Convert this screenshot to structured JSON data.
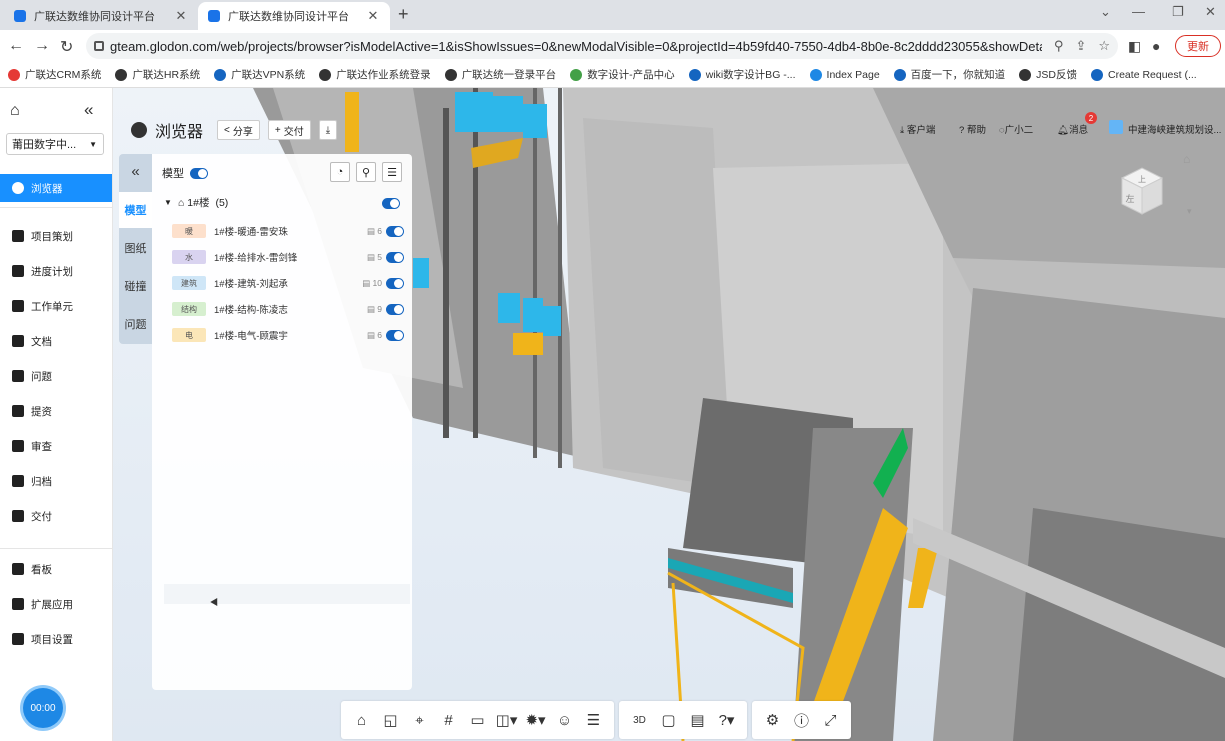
{
  "browser": {
    "tabs": [
      {
        "title": "广联达数维协同设计平台",
        "active": false
      },
      {
        "title": "广联达数维协同设计平台",
        "active": true
      }
    ],
    "url": "gteam.glodon.com/web/projects/browser?isModelActive=1&isShowIssues=0&newModalVisible=0&projectId=4b59fd40-7550-4db4-8b0e-8c2dddd23055&showDetail=0",
    "update_label": "更新",
    "bookmarks": [
      {
        "label": "广联达CRM系统",
        "color": "#e53935"
      },
      {
        "label": "广联达HR系统",
        "color": "#333333"
      },
      {
        "label": "广联达VPN系统",
        "color": "#1565c0"
      },
      {
        "label": "广联达作业系统登录",
        "color": "#333333"
      },
      {
        "label": "广联达统一登录平台",
        "color": "#333333"
      },
      {
        "label": "数字设计-产品中心",
        "color": "#43a047"
      },
      {
        "label": "wiki数字设计BG -...",
        "color": "#1565c0"
      },
      {
        "label": "Index Page",
        "color": "#1e88e5"
      },
      {
        "label": "百度一下，你就知道",
        "color": "#1565c0"
      },
      {
        "label": "JSD反馈",
        "color": "#333333"
      },
      {
        "label": "Create Request (...",
        "color": "#1565c0"
      }
    ]
  },
  "nav": {
    "project": "莆田数字中...",
    "items": [
      {
        "label": "浏览器",
        "active": true
      },
      {
        "label": "项目策划",
        "active": false
      },
      {
        "label": "进度计划",
        "active": false
      },
      {
        "label": "工作单元",
        "active": false
      },
      {
        "label": "文档",
        "active": false
      },
      {
        "label": "问题",
        "active": false
      },
      {
        "label": "提资",
        "active": false
      },
      {
        "label": "审查",
        "active": false
      },
      {
        "label": "归档",
        "active": false
      },
      {
        "label": "交付",
        "active": false
      },
      {
        "label": "看板",
        "active": false
      },
      {
        "label": "扩展应用",
        "active": false
      },
      {
        "label": "项目设置",
        "active": false
      }
    ],
    "timer": "00:00"
  },
  "header": {
    "title": "浏览器",
    "share": "分享",
    "deliver": "交付",
    "client": "客户端",
    "help": "帮助",
    "user": "广小二",
    "messages": "消息",
    "message_count": "2",
    "org": "中建海峡建筑规划设..."
  },
  "cube": {
    "top": "上",
    "front": "左"
  },
  "side_tabs": [
    "模型",
    "图纸",
    "碰撞",
    "问题"
  ],
  "panel": {
    "model_label": "模型",
    "root": "1#楼",
    "root_count": "(5)",
    "rows": [
      {
        "tag": "暖",
        "color": "#fde0cc",
        "name": "1#楼-暖通-雷安珠",
        "count": "6"
      },
      {
        "tag": "水",
        "color": "#d9d3f0",
        "name": "1#楼-给排水-雷剑锋",
        "count": "5"
      },
      {
        "tag": "建筑",
        "color": "#cfe6f7",
        "name": "1#楼-建筑-刘起承",
        "count": "10"
      },
      {
        "tag": "结构",
        "color": "#d6efcf",
        "name": "1#楼-结构-陈凌志",
        "count": "9"
      },
      {
        "tag": "电",
        "color": "#fbe6b8",
        "name": "1#楼-电气-顾震宇",
        "count": "6"
      }
    ]
  },
  "toolbar": {
    "groups": [
      [
        "home-icon",
        "section-box-icon",
        "location-icon",
        "grid-icon",
        "measure-icon",
        "section-plane-icon",
        "explode-icon",
        "person-icon",
        "properties-icon"
      ],
      [
        "3d-2d-icon",
        "camera-icon",
        "comment-icon",
        "help-icon"
      ],
      [
        "settings-icon",
        "info-icon",
        "fullscreen-icon"
      ]
    ],
    "glyphs": {
      "home-icon": "⌂",
      "section-box-icon": "◱",
      "location-icon": "⌖",
      "grid-icon": "#",
      "measure-icon": "▭",
      "section-plane-icon": "◫▾",
      "explode-icon": "✹▾",
      "person-icon": "☺",
      "properties-icon": "☰",
      "3d-2d-icon": "3D",
      "camera-icon": "▢",
      "comment-icon": "▤",
      "help-icon": "?▾",
      "settings-icon": "⚙",
      "info-icon": "ⓘ",
      "fullscreen-icon": "⤢"
    }
  }
}
